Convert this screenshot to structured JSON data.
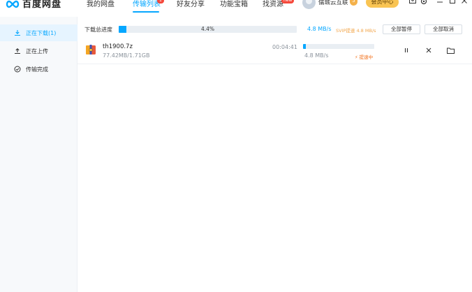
{
  "app": {
    "logo_text": "百度网盘"
  },
  "nav": {
    "items": [
      {
        "label": "我的网盘",
        "active": false
      },
      {
        "label": "传输列表",
        "active": true,
        "badge": "1"
      },
      {
        "label": "好友分享",
        "active": false
      },
      {
        "label": "功能宝箱",
        "active": false
      },
      {
        "label": "找资源",
        "active": false,
        "badge": "new"
      }
    ]
  },
  "user": {
    "name": "儒城云互联",
    "vip_level": "5",
    "member_button": "会员中心"
  },
  "window_icons": [
    "mail-icon",
    "settings-icon",
    "minimize-icon",
    "maximize-icon",
    "close-icon"
  ],
  "sidebar": {
    "items": [
      {
        "label": "正在下载(1)",
        "icon": "download-icon",
        "active": true
      },
      {
        "label": "正在上传",
        "icon": "upload-icon",
        "active": false
      },
      {
        "label": "传输完成",
        "icon": "check-circle-icon",
        "active": false
      }
    ]
  },
  "summary": {
    "label": "下载总进度",
    "progress_percent": 4.4,
    "progress_text": "4.4%",
    "speed": "4.8 MB/s",
    "svip_speed": "SVIP提速 4.8 MB/s",
    "pause_all": "全部暂停",
    "cancel_all": "全部取消"
  },
  "downloads": [
    {
      "name": "th1900.7z",
      "size": "77.42MB/1.71GB",
      "time_left": "00:04:41",
      "progress_percent": 4.4,
      "speed": "4.8 MB/s",
      "accel": "⚡ 提速中"
    }
  ],
  "colors": {
    "accent": "#06a7ff",
    "vip": "#f9c453",
    "accel": "#f2711c",
    "badge": "#f5483b"
  }
}
